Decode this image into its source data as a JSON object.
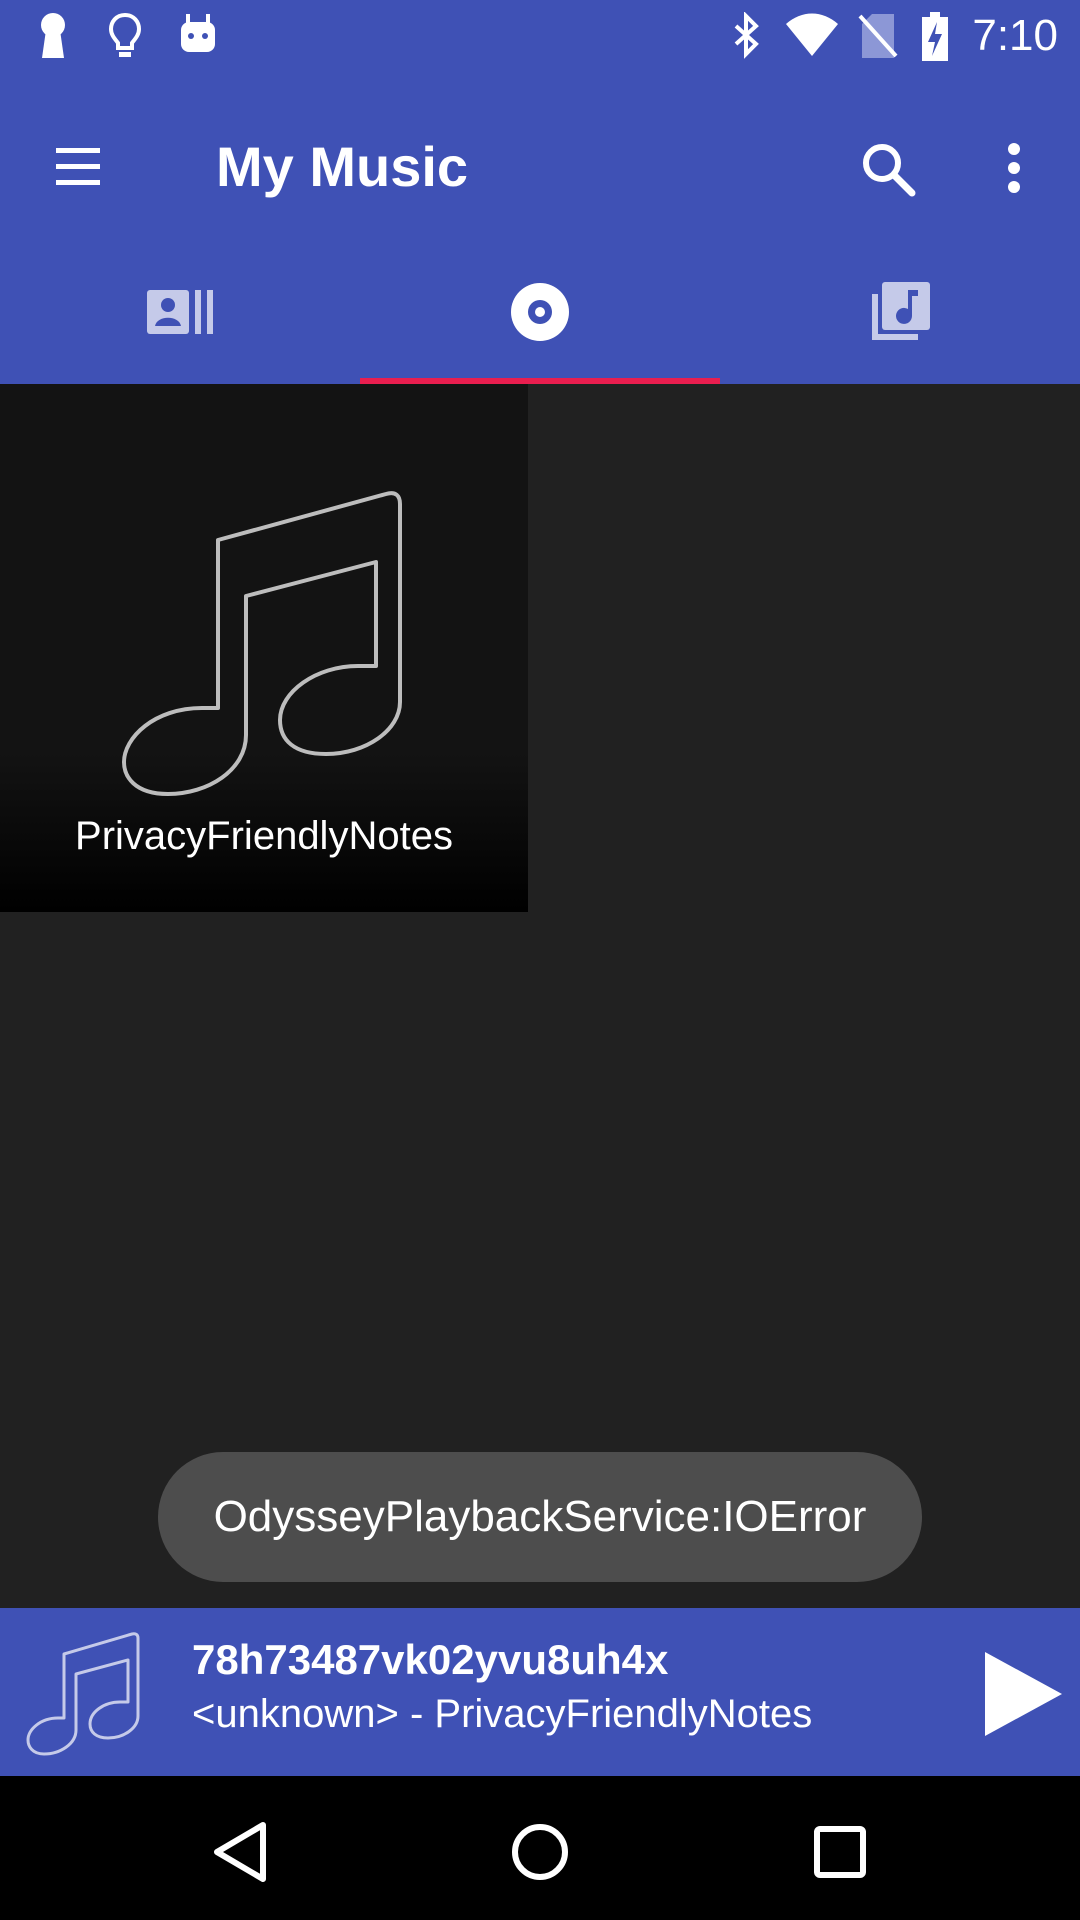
{
  "status_bar": {
    "time": "7:10",
    "left_icons": [
      "keyhole-icon",
      "lightbulb-icon",
      "android-icon"
    ],
    "right_icons": [
      "bluetooth-icon",
      "wifi-icon",
      "no-sim-icon",
      "battery-charging-icon"
    ]
  },
  "toolbar": {
    "title": "My Music",
    "icons": [
      "menu-icon",
      "search-icon",
      "more-vert-icon"
    ]
  },
  "tabs": [
    {
      "icon": "artists-icon",
      "selected": false
    },
    {
      "icon": "album-disc-icon",
      "selected": true
    },
    {
      "icon": "songs-library-icon",
      "selected": false
    }
  ],
  "albums": [
    {
      "name": "PrivacyFriendlyNotes",
      "art_icon": "music-note-icon"
    }
  ],
  "toast": {
    "message": "OdysseyPlaybackService:IOError"
  },
  "now_playing": {
    "title": "78h73487vk02yvu8uh4x",
    "subtitle": "<unknown> - PrivacyFriendlyNotes",
    "play_icon": "play-icon"
  },
  "nav_bar": {
    "icons": [
      "back-icon",
      "home-icon",
      "recents-icon"
    ]
  },
  "colors": {
    "primary": "#3F51B5",
    "accent": "#E91E4F",
    "background": "#212121",
    "toast": "#4D4D4D"
  }
}
